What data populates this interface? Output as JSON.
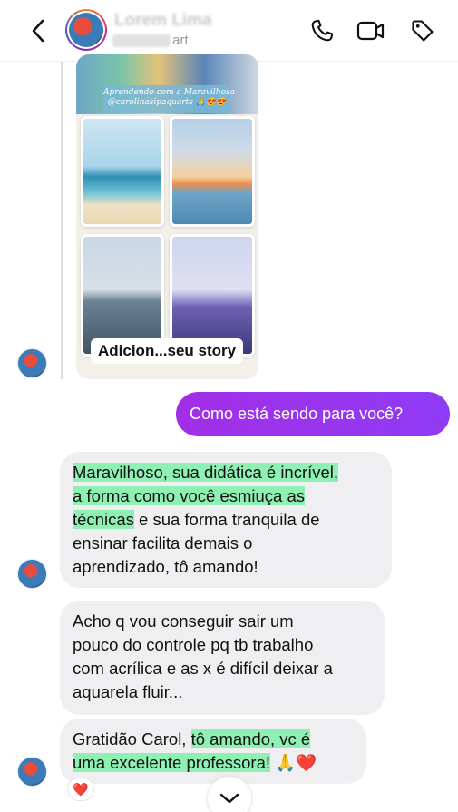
{
  "header": {
    "contact_name": "Lorem Lima",
    "subtitle_suffix": "art"
  },
  "story": {
    "caption_line1": "Aprendendo com a Maravilhosa",
    "caption_line2": "@carolinasipaquarts 🙏😍😍",
    "label": "Adicion...seu story"
  },
  "messages": {
    "sent": "Como está sendo para você?",
    "received_1_lines": [
      "Maravilhoso, sua didática é incrível,",
      "a forma como você esmiuça as",
      "técnicas",
      " e sua forma tranquila de",
      "ensinar facilita demais o",
      "aprendizado, tô amando!"
    ],
    "received_2_lines": [
      "Acho q vou conseguir sair um",
      "pouco do controle pq tb trabalho",
      "com acrílica e as x é difícil deixar a",
      "aquarela fluir..."
    ],
    "received_3": {
      "plain": "Gratidão Carol, ",
      "highlight_1": "tô amando, vc é",
      "highlight_2": "uma excelente professora!",
      "emoji": " 🙏❤️"
    },
    "reaction": "❤️"
  },
  "colors": {
    "sent_bubble": "#9b33ee",
    "received_bubble": "#efeff1",
    "highlight": "#8ff0b3"
  }
}
